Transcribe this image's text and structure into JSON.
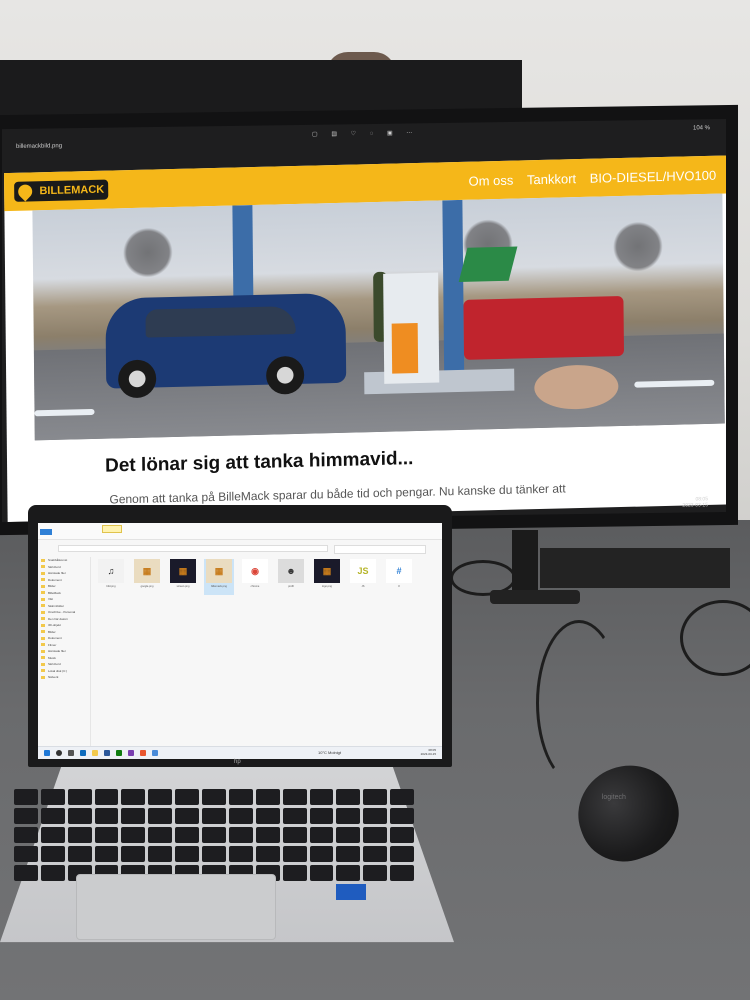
{
  "viewer": {
    "title": "billemackbild.png",
    "zoom": "104 %",
    "clock_time": "08:05",
    "clock_date": "2023-03-15"
  },
  "website": {
    "logo_text": "BILLEMACK",
    "nav": [
      "Om oss",
      "Tankkort",
      "BIO-DIESEL/HVO100"
    ],
    "heading": "Det lönar sig att tanka himmavid...",
    "intro": "Genom att tanka på BilleMack sparar du både tid och pengar. Nu kanske du tänker att",
    "accent_color": "#f5b719"
  },
  "laptop": {
    "brand": "hp",
    "explorer": {
      "sidebar_items": [
        "Snabbåtkomst",
        "Skrivbord",
        "Hämtade filer",
        "Dokument",
        "Bilder",
        "BilleMack",
        "Vikt",
        "Skärmbilder",
        "OneDrive - Personal",
        "Den här datorn",
        "3D-objekt",
        "Bilder",
        "Dokument",
        "Filmer",
        "Hämtade filer",
        "Musik",
        "Skrivbord",
        "Lokal disk (C:)",
        "Nätverk"
      ],
      "files": [
        {
          "label": "bild.png",
          "icon": "music-note-icon"
        },
        {
          "label": "google.png",
          "icon": "image-icon"
        },
        {
          "label": "screen.png",
          "icon": "image-icon"
        },
        {
          "label": "billemack.png",
          "icon": "image-icon"
        },
        {
          "label": "chrome",
          "icon": "chrome-icon"
        },
        {
          "label": "profil",
          "icon": "person-icon"
        },
        {
          "label": "logo.png",
          "icon": "image-icon"
        },
        {
          "label": "JS",
          "icon": "js-icon"
        },
        {
          "label": "#",
          "icon": "csharp-icon"
        }
      ]
    },
    "taskbar": {
      "weather": "10°C Molnigt",
      "time": "08:05",
      "date": "2023-03-15"
    }
  },
  "mouse": {
    "brand": "logitech"
  }
}
